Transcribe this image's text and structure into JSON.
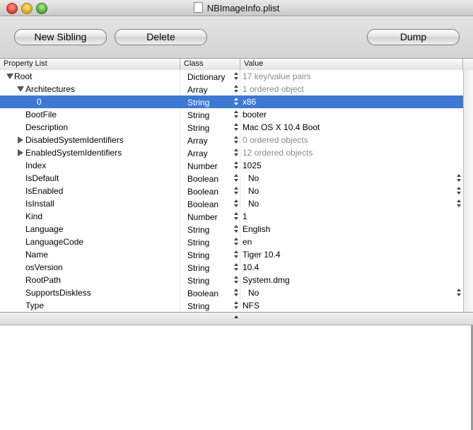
{
  "window": {
    "title": "NBImageInfo.plist"
  },
  "toolbar": {
    "new_sibling_label": "New Sibling",
    "delete_label": "Delete",
    "dump_label": "Dump"
  },
  "table": {
    "headers": {
      "property": "Property List",
      "class": "Class",
      "value": "Value"
    },
    "rows": [
      {
        "key": "Root",
        "class": "Dictionary",
        "value": "17 key/value pairs"
      },
      {
        "key": "Architectures",
        "class": "Array",
        "value": "1 ordered object"
      },
      {
        "key": "0",
        "class": "String",
        "value": "x86"
      },
      {
        "key": "BootFile",
        "class": "String",
        "value": "booter"
      },
      {
        "key": "Description",
        "class": "String",
        "value": "Mac OS X 10.4 Boot"
      },
      {
        "key": "DisabledSystemIdentifiers",
        "class": "Array",
        "value": "0 ordered objects"
      },
      {
        "key": "EnabledSystemIdentifiers",
        "class": "Array",
        "value": "12 ordered objects"
      },
      {
        "key": "Index",
        "class": "Number",
        "value": "1025"
      },
      {
        "key": "IsDefault",
        "class": "Boolean",
        "value": "No"
      },
      {
        "key": "IsEnabled",
        "class": "Boolean",
        "value": "No"
      },
      {
        "key": "IsInstall",
        "class": "Boolean",
        "value": "No"
      },
      {
        "key": "Kind",
        "class": "Number",
        "value": "1"
      },
      {
        "key": "Language",
        "class": "String",
        "value": "English"
      },
      {
        "key": "LanguageCode",
        "class": "String",
        "value": "en"
      },
      {
        "key": "Name",
        "class": "String",
        "value": "Tiger 10.4"
      },
      {
        "key": "osVersion",
        "class": "String",
        "value": "10.4"
      },
      {
        "key": "RootPath",
        "class": "String",
        "value": "System.dmg"
      },
      {
        "key": "SupportsDiskless",
        "class": "Boolean",
        "value": "No"
      },
      {
        "key": "Type",
        "class": "String",
        "value": "NFS"
      }
    ]
  },
  "colors": {
    "selection": "#3d79d3"
  }
}
